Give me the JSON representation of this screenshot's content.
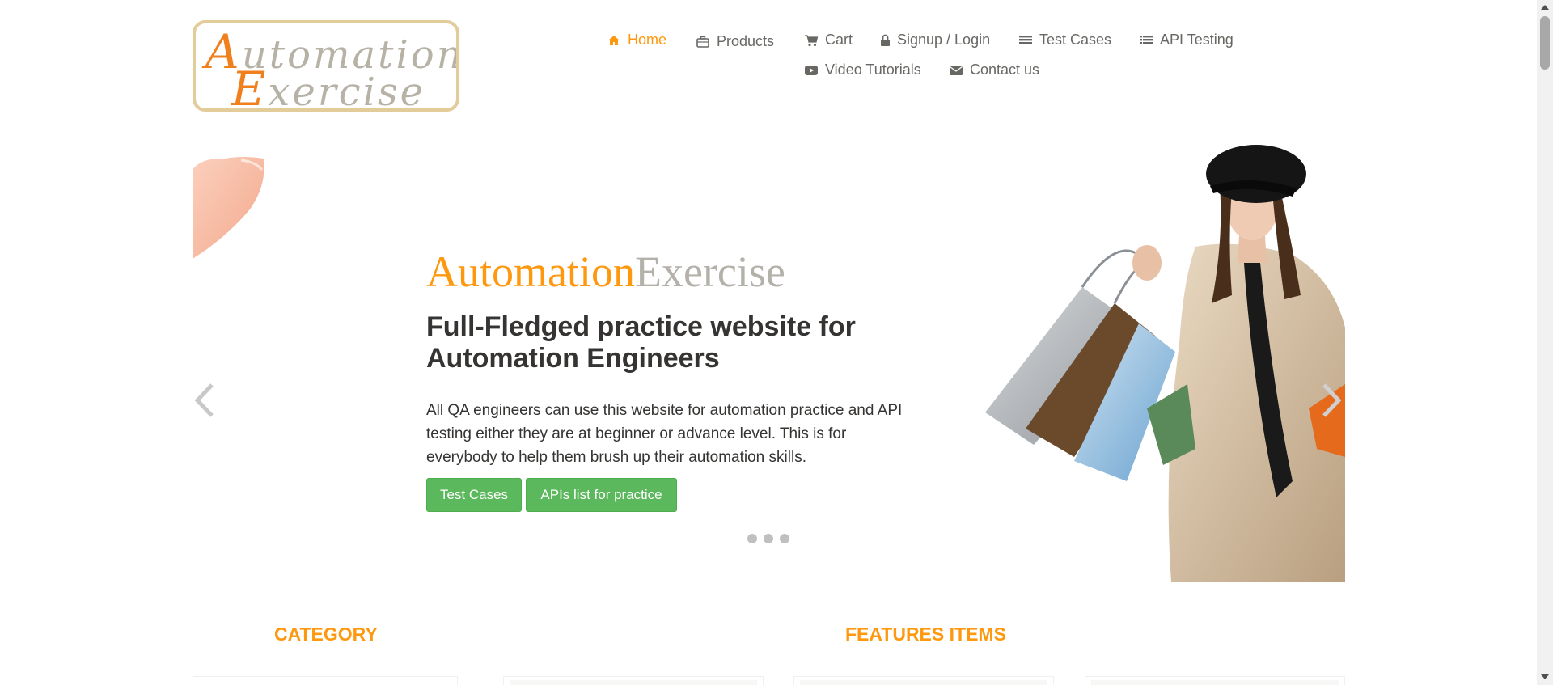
{
  "logo": {
    "line1_cap": "A",
    "line1_rest": "utomation",
    "line2_cap": "E",
    "line2_rest": "xercise"
  },
  "nav": {
    "items": [
      {
        "label": "Home",
        "icon": "home-icon",
        "active": true
      },
      {
        "label": "Products",
        "icon": "briefcase-icon"
      },
      {
        "label": "Cart",
        "icon": "cart-icon"
      },
      {
        "label": "Signup / Login",
        "icon": "lock-icon"
      },
      {
        "label": "Test Cases",
        "icon": "list-icon"
      },
      {
        "label": "API Testing",
        "icon": "list-icon"
      },
      {
        "label": "Video Tutorials",
        "icon": "youtube-play-icon"
      },
      {
        "label": "Contact us",
        "icon": "envelope-icon"
      }
    ]
  },
  "slider": {
    "brand_part1": "Automation",
    "brand_part2": "Exercise",
    "headline": "Full-Fledged practice website for Automation Engineers",
    "description": "All QA engineers can use this website for automation practice and API testing either they are at beginner or advance level. This is for everybody to help them brush up their automation skills.",
    "button_test_cases": "Test Cases",
    "button_apis": "APIs list for practice",
    "indicators": 3
  },
  "sections": {
    "category_title": "CATEGORY",
    "features_title": "FEATURES ITEMS"
  },
  "colors": {
    "accent": "#fe980f",
    "button_green": "#5cb85c",
    "text_dark": "#363432",
    "text_nav": "#696763"
  }
}
